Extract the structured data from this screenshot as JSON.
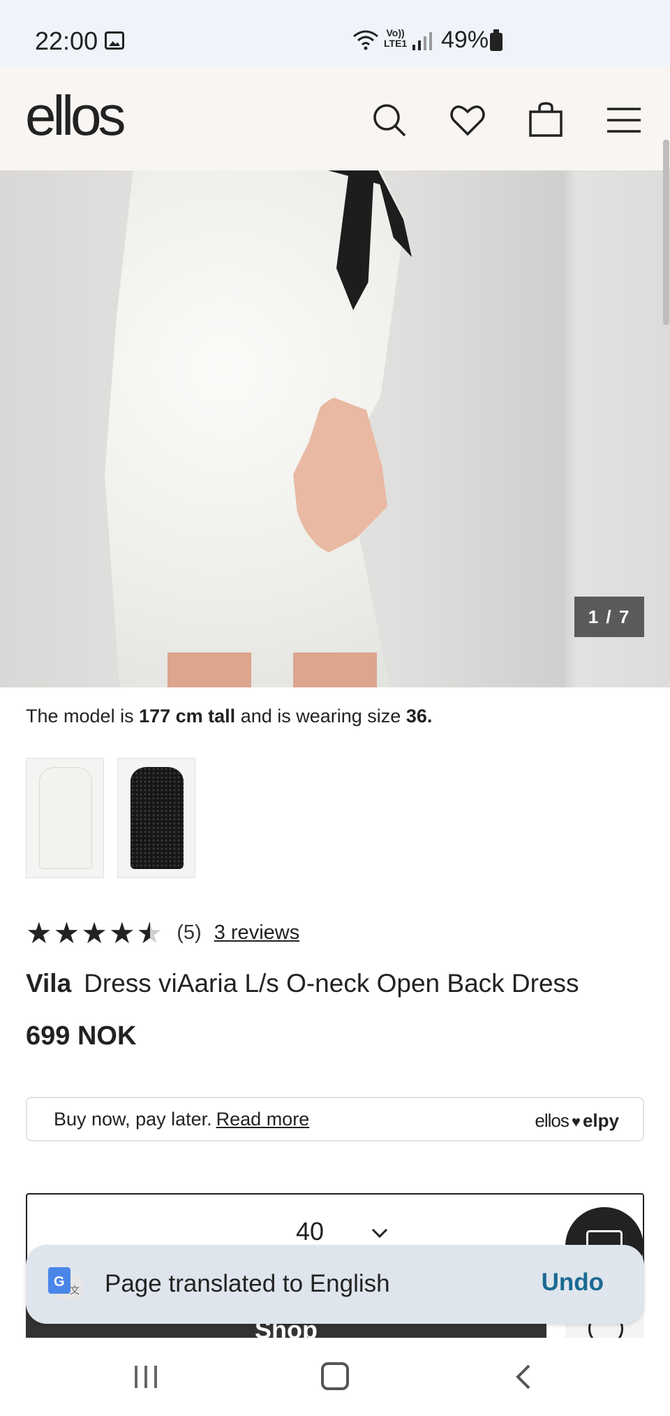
{
  "status_bar": {
    "time": "22:00",
    "volte_line1": "Vo))",
    "volte_line2": "LTE1",
    "battery": "49%"
  },
  "header": {
    "logo": "ellos",
    "icons": [
      "search-icon",
      "heart-icon",
      "bag-icon",
      "menu-icon"
    ]
  },
  "gallery": {
    "counter": "1 / 7"
  },
  "model_info": {
    "prefix": "The model is",
    "height": "177 cm tall",
    "middle": "and is wearing size",
    "size": "36."
  },
  "variants": [
    {
      "name": "white-dress",
      "color": "#f2f2ef"
    },
    {
      "name": "black-dress",
      "color": "#161616"
    }
  ],
  "rating": {
    "stars": 4.5,
    "count": "(5)",
    "reviews_link": "3 reviews"
  },
  "product": {
    "brand": "Vila",
    "name": "Dress viAaria L/s O-neck Open Back Dress",
    "price": "699 NOK"
  },
  "paylater": {
    "text": "Buy now, pay later.",
    "link": "Read more",
    "brand_left": "ellos",
    "brand_right": "elpy"
  },
  "size_selector": {
    "value": "40"
  },
  "shop_button": {
    "label": "Shop"
  },
  "toast": {
    "message": "Page translated to English",
    "action": "Undo"
  },
  "colors": {
    "accent": "#1a6a92",
    "header_bg": "#f8f5f2",
    "status_bg": "#eef4fa"
  }
}
